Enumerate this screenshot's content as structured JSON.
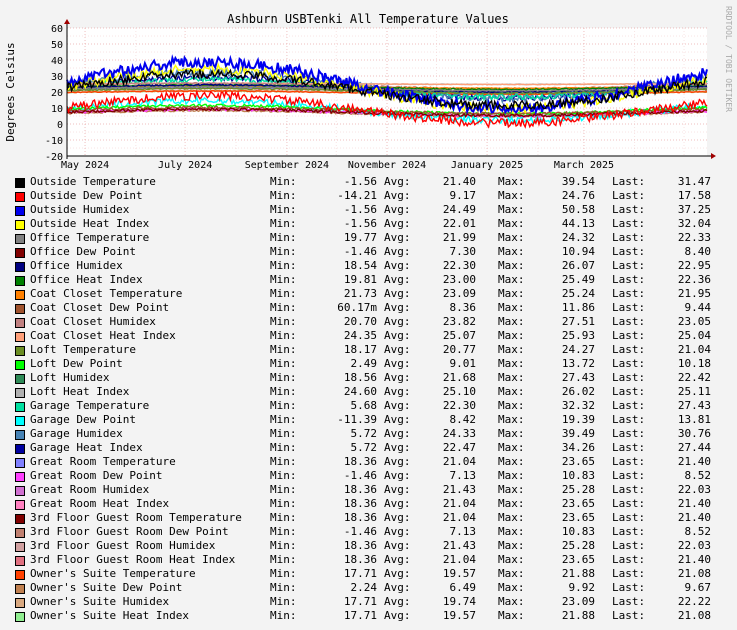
{
  "watermark": "RRDTOOL / TOBI OETIKER",
  "chart_data": {
    "type": "line",
    "title": "Ashburn USBTenki All Temperature Values",
    "ylabel": "Degrees Celsius",
    "ylim": [
      -20,
      60
    ],
    "yticks": [
      -20,
      -10,
      0,
      10,
      20,
      30,
      40,
      50,
      60
    ],
    "xticks": [
      "May 2024",
      "July 2024",
      "September 2024",
      "November 2024",
      "January 2025",
      "March 2025"
    ],
    "x_range": [
      "2024-04-20",
      "2025-05-15"
    ],
    "grid": true,
    "legend_position": "bottom",
    "stat_labels": {
      "min": "Min:",
      "avg": "Avg:",
      "max": "Max:",
      "last": "Last:"
    },
    "series": [
      {
        "name": "Outside Temperature",
        "color": "#000000",
        "min": "-1.56",
        "avg": "21.40",
        "max": "39.54",
        "last": "31.47"
      },
      {
        "name": "Outside Dew Point",
        "color": "#ff0000",
        "min": "-14.21",
        "avg": "9.17",
        "max": "24.76",
        "last": "17.58"
      },
      {
        "name": "Outside Humidex",
        "color": "#0000ee",
        "min": "-1.56",
        "avg": "24.49",
        "max": "50.58",
        "last": "37.25"
      },
      {
        "name": "Outside Heat Index",
        "color": "#ffff00",
        "min": "-1.56",
        "avg": "22.01",
        "max": "44.13",
        "last": "32.04"
      },
      {
        "name": "Office Temperature",
        "color": "#808080",
        "min": "19.77",
        "avg": "21.99",
        "max": "24.32",
        "last": "22.33"
      },
      {
        "name": "Office Dew Point",
        "color": "#800000",
        "min": "-1.46",
        "avg": "7.30",
        "max": "10.94",
        "last": "8.40"
      },
      {
        "name": "Office Humidex",
        "color": "#000080",
        "min": "18.54",
        "avg": "22.30",
        "max": "26.07",
        "last": "22.95"
      },
      {
        "name": "Office Heat Index",
        "color": "#008000",
        "min": "19.81",
        "avg": "23.00",
        "max": "25.49",
        "last": "22.36"
      },
      {
        "name": "Coat Closet Temperature",
        "color": "#ff8000",
        "min": "21.73",
        "avg": "23.09",
        "max": "25.24",
        "last": "21.95"
      },
      {
        "name": "Coat Closet Dew Point",
        "color": "#a0522d",
        "min": "60.17m",
        "avg": "8.36",
        "max": "11.86",
        "last": "9.44"
      },
      {
        "name": "Coat Closet Humidex",
        "color": "#c08080",
        "min": "20.70",
        "avg": "23.82",
        "max": "27.51",
        "last": "23.05"
      },
      {
        "name": "Coat Closet Heat Index",
        "color": "#ffa07a",
        "min": "24.35",
        "avg": "25.07",
        "max": "25.93",
        "last": "25.04"
      },
      {
        "name": "Loft Temperature",
        "color": "#6b8e23",
        "min": "18.17",
        "avg": "20.77",
        "max": "24.27",
        "last": "21.04"
      },
      {
        "name": "Loft Dew Point",
        "color": "#00ff00",
        "min": "2.49",
        "avg": "9.01",
        "max": "13.72",
        "last": "10.18"
      },
      {
        "name": "Loft Humidex",
        "color": "#2e8b57",
        "min": "18.56",
        "avg": "21.68",
        "max": "27.43",
        "last": "22.42"
      },
      {
        "name": "Loft Heat Index",
        "color": "#b0b0b0",
        "min": "24.60",
        "avg": "25.10",
        "max": "26.02",
        "last": "25.11"
      },
      {
        "name": "Garage Temperature",
        "color": "#00e0a0",
        "min": "5.68",
        "avg": "22.30",
        "max": "32.32",
        "last": "27.43"
      },
      {
        "name": "Garage Dew Point",
        "color": "#00ffff",
        "min": "-11.39",
        "avg": "8.42",
        "max": "19.39",
        "last": "13.81"
      },
      {
        "name": "Garage Humidex",
        "color": "#4682b4",
        "min": "5.72",
        "avg": "24.33",
        "max": "39.49",
        "last": "30.76"
      },
      {
        "name": "Garage Heat Index",
        "color": "#0000a0",
        "min": "5.72",
        "avg": "22.47",
        "max": "34.26",
        "last": "27.44"
      },
      {
        "name": "Great Room Temperature",
        "color": "#8080ff",
        "min": "18.36",
        "avg": "21.04",
        "max": "23.65",
        "last": "21.40"
      },
      {
        "name": "Great Room Dew Point",
        "color": "#ff40ff",
        "min": "-1.46",
        "avg": "7.13",
        "max": "10.83",
        "last": "8.52"
      },
      {
        "name": "Great Room Humidex",
        "color": "#d070d0",
        "min": "18.36",
        "avg": "21.43",
        "max": "25.28",
        "last": "22.03"
      },
      {
        "name": "Great Room Heat Index",
        "color": "#ff80c0",
        "min": "18.36",
        "avg": "21.04",
        "max": "23.65",
        "last": "21.40"
      },
      {
        "name": "3rd Floor Guest Room Temperature",
        "color": "#800000",
        "min": "18.36",
        "avg": "21.04",
        "max": "23.65",
        "last": "21.40"
      },
      {
        "name": "3rd Floor Guest Room Dew Point",
        "color": "#c08070",
        "min": "-1.46",
        "avg": "7.13",
        "max": "10.83",
        "last": "8.52"
      },
      {
        "name": "3rd Floor Guest Room Humidex",
        "color": "#d0a0a0",
        "min": "18.36",
        "avg": "21.43",
        "max": "25.28",
        "last": "22.03"
      },
      {
        "name": "3rd Floor Guest Room Heat Index",
        "color": "#e07080",
        "min": "18.36",
        "avg": "21.04",
        "max": "23.65",
        "last": "21.40"
      },
      {
        "name": "Owner's Suite Temperature",
        "color": "#ff4000",
        "min": "17.71",
        "avg": "19.57",
        "max": "21.88",
        "last": "21.08"
      },
      {
        "name": "Owner's Suite Dew Point",
        "color": "#c08050",
        "min": "2.24",
        "avg": "6.49",
        "max": "9.92",
        "last": "9.67"
      },
      {
        "name": "Owner's Suite Humidex",
        "color": "#d8a880",
        "min": "17.71",
        "avg": "19.74",
        "max": "23.09",
        "last": "22.22"
      },
      {
        "name": "Owner's Suite Heat Index",
        "color": "#90ee90",
        "min": "17.71",
        "avg": "19.57",
        "max": "21.88",
        "last": "21.08"
      }
    ]
  }
}
